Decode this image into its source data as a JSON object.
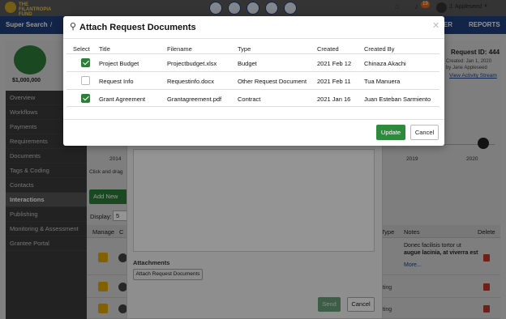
{
  "topbar": {
    "logo_text": "THE FILANTROPIA FUND",
    "icons": [
      "plus-icon",
      "search-icon",
      "notes-icon",
      "list-icon",
      "settings-icon"
    ],
    "notification_count": "19",
    "user_name": "J. Appleseed"
  },
  "nav": {
    "left": "Super Search",
    "separator": "/",
    "right": [
      "TER",
      "REPORTS"
    ]
  },
  "request": {
    "amount": "$1,000,000",
    "id_label": "Request ID:",
    "id_value": "444",
    "created": "Created: Jan 1, 2020",
    "created_by": "by Jane Appleseed",
    "activity_link": "View Activity Stream"
  },
  "sidebar": {
    "items": [
      "Overview",
      "Workflows",
      "Payments",
      "Requirements",
      "Documents",
      "Tags & Coding",
      "Contacts",
      "Interactions",
      "Publishing",
      "Monitoring & Assessment",
      "Grantee Portal"
    ],
    "active": "Interactions"
  },
  "timeline": {
    "labels": [
      "2014",
      "2019",
      "2020"
    ],
    "hint": "Click and drag"
  },
  "interactions": {
    "add_label": "Add New",
    "display_label": "Display:",
    "display_value": "5",
    "columns": [
      "Manage",
      "C",
      "Type",
      "Notes",
      "Delete"
    ],
    "note_line1": "Donec facilisis tortor ut",
    "note_line2": "augue lacinia, at viverra est",
    "note_more": "More...",
    "row_text": "eting"
  },
  "compose": {
    "attachments_label": "Attachments",
    "attach_button": "Attach Request Documents",
    "send": "Send",
    "cancel": "Cancel"
  },
  "dialog": {
    "title": "Attach Request Documents",
    "columns": {
      "select": "Select",
      "title": "Title",
      "filename": "Filename",
      "type": "Type",
      "created": "Created",
      "created_by": "Created By"
    },
    "rows": [
      {
        "checked": true,
        "title": "Project Budget",
        "filename": "Projectbudget.xlsx",
        "type": "Budget",
        "created": "2021 Feb 12",
        "created_by": "Chinaza Akachi"
      },
      {
        "checked": false,
        "title": "Request Info",
        "filename": "Requestinfo.docx",
        "type": "Other Request Document",
        "created": "2021 Feb 11",
        "created_by": "Tua Manuera"
      },
      {
        "checked": true,
        "title": "Grant Agreement",
        "filename": "Grantagreement.pdf",
        "type": "Contract",
        "created": "2021 Jan 16",
        "created_by": "Juan Esteban Sarmiento"
      }
    ],
    "update": "Update",
    "cancel": "Cancel"
  },
  "colors": {
    "navy": "#1f3f7a",
    "green": "#2e8b3e",
    "sidebar": "#3b3b3b"
  }
}
